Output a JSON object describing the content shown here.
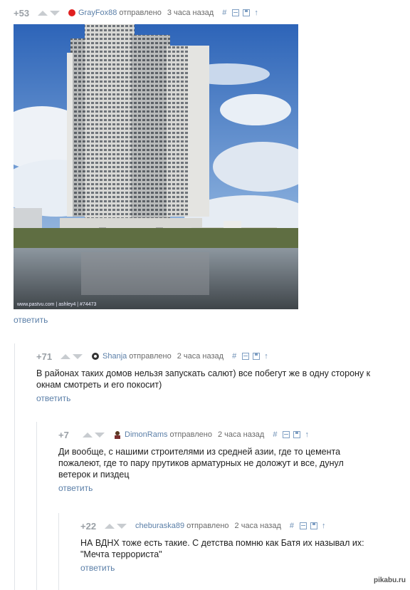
{
  "comments": [
    {
      "rating": "+53",
      "author": "GrayFox88",
      "sent": "отправлено",
      "time": "3 часа назад",
      "tool_hash": "#",
      "reply": "ответить",
      "text": "",
      "photo": {
        "watermark": "www.pastvu.com | ashley4 | #74473"
      }
    },
    {
      "rating": "+71",
      "author": "Shanja",
      "sent": "отправлено",
      "time": "2 часа назад",
      "tool_hash": "#",
      "reply": "ответить",
      "text": "В районах таких домов нельзя запускать салют) все побегут же в одну сторону к окнам смотреть и его покосит)"
    },
    {
      "rating": "+7",
      "author": "DimonRams",
      "sent": "отправлено",
      "time": "2 часа назад",
      "tool_hash": "#",
      "reply": "ответить",
      "text": "Ди вообще, с нашими строителями из средней азии, где то цемента пожалеют, где то пару прутиков арматурных не доложут и все, дунул ветерок и пиздец"
    },
    {
      "rating": "+22",
      "author": "cheburaska89",
      "sent": "отправлено",
      "time": "2 часа назад",
      "tool_hash": "#",
      "reply": "ответить",
      "text": "НА ВДНХ тоже есть такие. С детства помню как Батя их называл их: \"Мечта террориста\""
    }
  ],
  "site_logo": "pikabu.ru"
}
